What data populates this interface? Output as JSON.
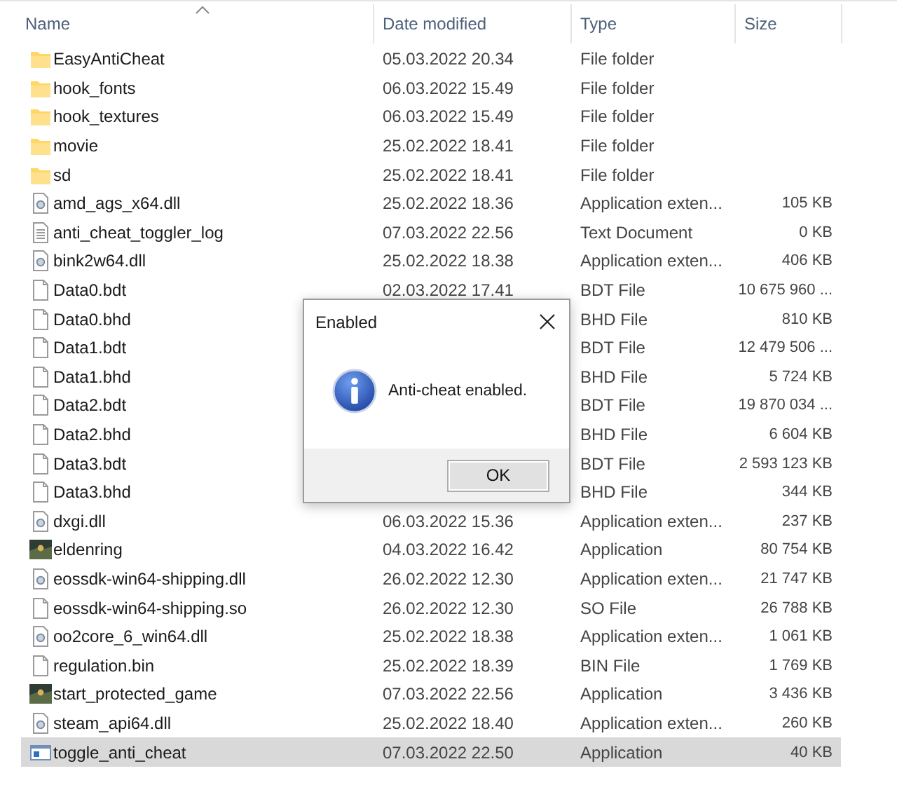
{
  "columns": [
    {
      "label": "Name",
      "sorted": true
    },
    {
      "label": "Date modified",
      "sorted": false
    },
    {
      "label": "Type",
      "sorted": false
    },
    {
      "label": "Size",
      "sorted": false
    }
  ],
  "files": [
    {
      "kind": "folder",
      "name": "EasyAntiCheat",
      "date": "05.03.2022 20.34",
      "type": "File folder",
      "selected": false
    },
    {
      "kind": "folder",
      "name": "hook_fonts",
      "date": "06.03.2022 15.49",
      "type": "File folder",
      "selected": false
    },
    {
      "kind": "folder",
      "name": "hook_textures",
      "date": "06.03.2022 15.49",
      "type": "File folder",
      "selected": false
    },
    {
      "kind": "folder",
      "name": "movie",
      "date": "25.02.2022 18.41",
      "type": "File folder",
      "selected": false
    },
    {
      "kind": "folder",
      "name": "sd",
      "date": "25.02.2022 18.41",
      "type": "File folder",
      "selected": false
    },
    {
      "kind": "dll",
      "name": "amd_ags_x64.dll",
      "date": "25.02.2022 18.36",
      "type": "Application exten...",
      "size": "105 KB",
      "selected": false
    },
    {
      "kind": "text",
      "name": "anti_cheat_toggler_log",
      "date": "07.03.2022 22.56",
      "type": "Text Document",
      "size": "0 KB",
      "selected": false
    },
    {
      "kind": "dll",
      "name": "bink2w64.dll",
      "date": "25.02.2022 18.38",
      "type": "Application exten...",
      "size": "406 KB",
      "selected": false
    },
    {
      "kind": "blank",
      "name": "Data0.bdt",
      "date": "02.03.2022 17.41",
      "type": "BDT File",
      "size": "10 675 960 ...",
      "selected": false
    },
    {
      "kind": "blank",
      "name": "Data0.bhd",
      "type": "BHD File",
      "size": "810 KB",
      "selected": false
    },
    {
      "kind": "blank",
      "name": "Data1.bdt",
      "type": "BDT File",
      "size": "12 479 506 ...",
      "selected": false
    },
    {
      "kind": "blank",
      "name": "Data1.bhd",
      "type": "BHD File",
      "size": "5 724 KB",
      "selected": false
    },
    {
      "kind": "blank",
      "name": "Data2.bdt",
      "type": "BDT File",
      "size": "19 870 034 ...",
      "selected": false
    },
    {
      "kind": "blank",
      "name": "Data2.bhd",
      "type": "BHD File",
      "size": "6 604 KB",
      "selected": false
    },
    {
      "kind": "blank",
      "name": "Data3.bdt",
      "type": "BDT File",
      "size": "2 593 123 KB",
      "selected": false
    },
    {
      "kind": "blank",
      "name": "Data3.bhd",
      "type": "BHD File",
      "size": "344 KB",
      "selected": false
    },
    {
      "kind": "dll",
      "name": "dxgi.dll",
      "date": "06.03.2022 15.36",
      "type": "Application exten...",
      "size": "237 KB",
      "selected": false
    },
    {
      "kind": "game",
      "name": "eldenring",
      "date": "04.03.2022 16.42",
      "type": "Application",
      "size": "80 754 KB",
      "selected": false
    },
    {
      "kind": "dll",
      "name": "eossdk-win64-shipping.dll",
      "date": "26.02.2022 12.30",
      "type": "Application exten...",
      "size": "21 747 KB",
      "selected": false
    },
    {
      "kind": "blank",
      "name": "eossdk-win64-shipping.so",
      "date": "26.02.2022 12.30",
      "type": "SO File",
      "size": "26 788 KB",
      "selected": false
    },
    {
      "kind": "dll",
      "name": "oo2core_6_win64.dll",
      "date": "25.02.2022 18.38",
      "type": "Application exten...",
      "size": "1 061 KB",
      "selected": false
    },
    {
      "kind": "blank",
      "name": "regulation.bin",
      "date": "25.02.2022 18.39",
      "type": "BIN File",
      "size": "1 769 KB",
      "selected": false
    },
    {
      "kind": "game",
      "name": "start_protected_game",
      "date": "07.03.2022 22.56",
      "type": "Application",
      "size": "3 436 KB",
      "selected": false
    },
    {
      "kind": "dll",
      "name": "steam_api64.dll",
      "date": "25.02.2022 18.40",
      "type": "Application exten...",
      "size": "260 KB",
      "selected": false
    },
    {
      "kind": "app",
      "name": "toggle_anti_cheat",
      "date": "07.03.2022 22.50",
      "type": "Application",
      "size": "40 KB",
      "selected": true
    }
  ],
  "dialog": {
    "title": "Enabled",
    "message": "Anti-cheat enabled.",
    "kind": "info",
    "buttons": [
      "OK"
    ]
  }
}
